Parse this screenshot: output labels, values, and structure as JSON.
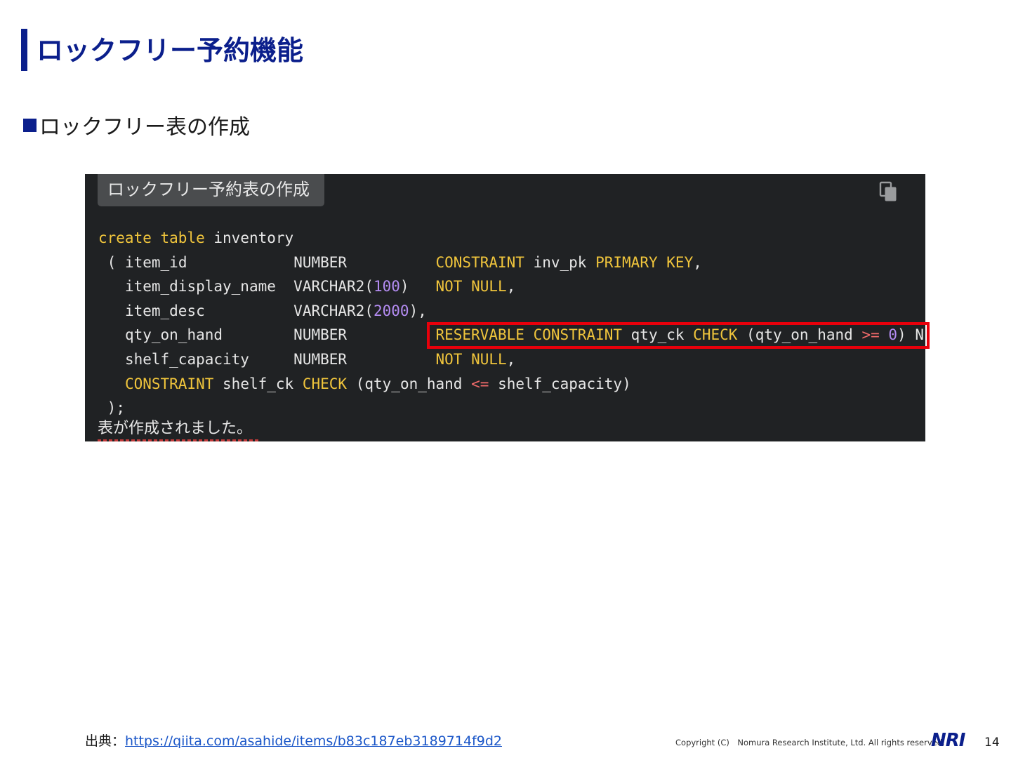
{
  "page": {
    "title": "ロックフリー予約機能",
    "section_heading": "ロックフリー表の作成"
  },
  "code_block": {
    "tab_label": "ロックフリー予約表の作成",
    "copy_icon": "copy-icon",
    "lines": [
      "create table inventory",
      " ( item_id            NUMBER          CONSTRAINT inv_pk PRIMARY KEY,",
      "   item_display_name  VARCHAR2(100)   NOT NULL,",
      "   item_desc          VARCHAR2(2000),",
      "   qty_on_hand        NUMBER          RESERVABLE CONSTRAINT qty_ck CHECK (qty_on_hand >= 0) N",
      "   shelf_capacity     NUMBER          NOT NULL,",
      "   CONSTRAINT shelf_ck CHECK (qty_on_hand <= shelf_capacity)",
      " );"
    ],
    "result_message": "表が作成されました。",
    "highlight_color": "#e8000b"
  },
  "footer": {
    "source_label": "出典：",
    "source_url": "https://qiita.com/asahide/items/b83c187eb3189714f9d2",
    "copyright": "Copyright (C)　Nomura Research Institute, Ltd. All rights reserved.",
    "logo_text": "NRI",
    "page_number": "14"
  },
  "colors": {
    "brand_blue": "#0b1f8c",
    "code_background": "#202224",
    "keyword": "#f0c53c",
    "number": "#b48cf2",
    "operator": "#f06a6a"
  }
}
